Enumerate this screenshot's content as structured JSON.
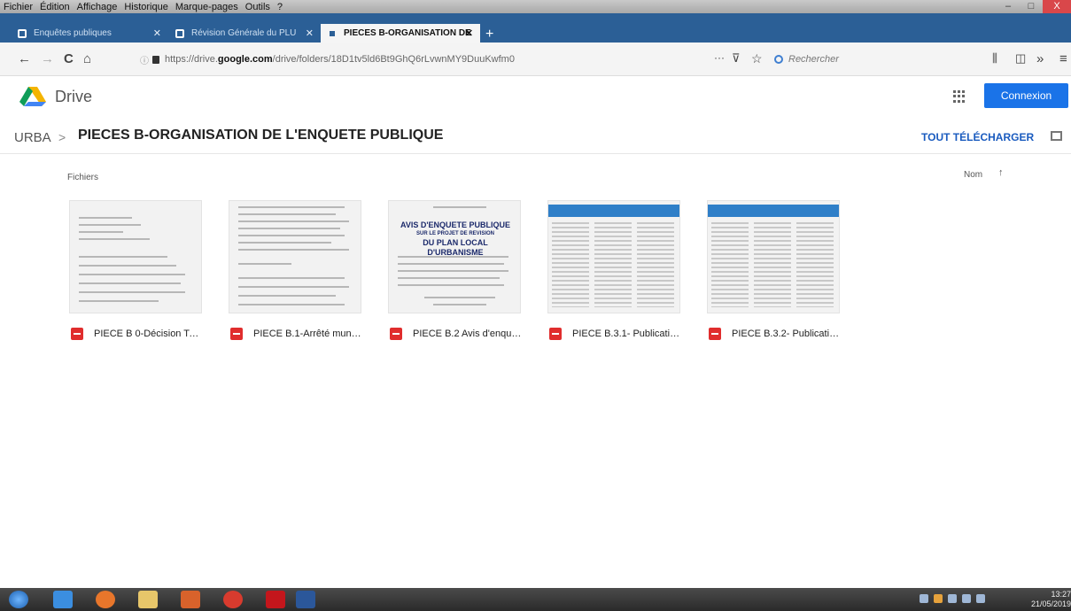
{
  "menu": [
    "Fichier",
    "Édition",
    "Affichage",
    "Historique",
    "Marque-pages",
    "Outils",
    "?"
  ],
  "tabs": [
    {
      "label": "Enquêtes publiques",
      "active": false
    },
    {
      "label": "Révision Générale du PLU",
      "active": false
    },
    {
      "label": "PIECES B-ORGANISATION DE",
      "active": true
    }
  ],
  "tab_close": "✕",
  "new_tab": "+",
  "nav": {
    "back": "←",
    "forward": "→",
    "reload": "C",
    "home": "⌂",
    "url_prefix": "https://drive.",
    "url_domain": "google.com",
    "url_path": "/drive/folders/18D1tv5ld6Bt9GhQ6rLvwnMY9DuuKwfm0",
    "page_actions": "···",
    "bookmark": "☆",
    "search_placeholder": "Rechercher",
    "library": "⫼",
    "sidebar": "◫",
    "overflow": "»",
    "menu": "≡"
  },
  "window": {
    "minimize": "–",
    "maximize": "□",
    "close": "X"
  },
  "drive": {
    "app_name": "Drive",
    "signin_label": "Connexion"
  },
  "breadcrumb": {
    "root": "URBA",
    "separator": ">",
    "title": "PIECES B-ORGANISATION DE L'ENQUETE PUBLIQUE"
  },
  "download_all": "TOUT TÉLÉCHARGER",
  "files_label": "Fichiers",
  "sort": {
    "label": "Nom",
    "arrow": "↑"
  },
  "files": [
    {
      "name": "PIECE B 0-Décision TA ..."
    },
    {
      "name": "PIECE B.1-Arrêté munic..."
    },
    {
      "name": "PIECE B.2 Avis d'enquê..."
    },
    {
      "name": "PIECE B.3.1- Publicatio..."
    },
    {
      "name": "PIECE B.3.2- Publicatio..."
    }
  ],
  "avis_thumb": {
    "line1": "AVIS D'ENQUETE PUBLIQUE",
    "line2": "SUR LE PROJET DE REVISION",
    "line3": "DU PLAN LOCAL D'URBANISME"
  },
  "clock": {
    "time": "13:27",
    "date": "21/05/2019"
  },
  "colors": {
    "accent": "#1a73e8",
    "tabstrip": "#2b5f96",
    "pdf": "#e02d2d",
    "link": "#1a5bbf"
  }
}
